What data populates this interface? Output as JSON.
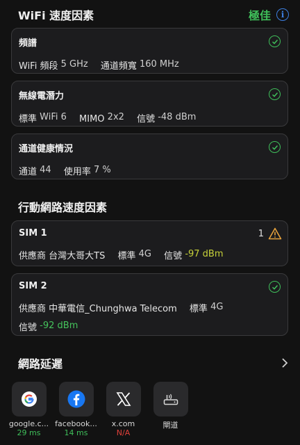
{
  "wifi_section": {
    "title": "WiFi 速度因素",
    "rating": "極佳",
    "rating_color": "#3fbf5a",
    "info_icon": "info-icon"
  },
  "cards": {
    "spectrum": {
      "title": "頻譜",
      "status": "ok",
      "band_label": "WiFi 頻段",
      "band_value": "5 GHz",
      "width_label": "通道頻寬",
      "width_value": "160 MHz"
    },
    "radio": {
      "title": "無線電潛力",
      "status": "ok",
      "std_label": "標準",
      "std_value": "WiFi 6",
      "mimo_label": "MIMO",
      "mimo_value": "2x2",
      "signal_label": "信號",
      "signal_value": "-48 dBm"
    },
    "channel": {
      "title": "通道健康情況",
      "status": "ok",
      "channel_label": "通道",
      "channel_value": "44",
      "usage_label": "使用率",
      "usage_value": "7 %"
    }
  },
  "mobile_section": {
    "title": "行動網路速度因素"
  },
  "sims": {
    "sim1": {
      "title": "SIM 1",
      "warning_count": "1",
      "carrier_label": "供應商",
      "carrier_value": "台灣大哥大TS",
      "std_label": "標準",
      "std_value": "4G",
      "signal_label": "信號",
      "signal_value": "-97 dBm",
      "signal_color": "#c7d23a"
    },
    "sim2": {
      "title": "SIM 2",
      "status": "ok",
      "carrier_label": "供應商",
      "carrier_value": "中華電信_Chunghwa Telecom",
      "std_label": "標準",
      "std_value": "4G",
      "signal_label": "信號",
      "signal_value": "-92 dBm",
      "signal_color": "#45c45c"
    }
  },
  "latency_section": {
    "title": "網路延遲",
    "targets": [
      {
        "name": "google.c...",
        "value": "29 ms",
        "icon": "google-icon",
        "state": "good"
      },
      {
        "name": "facebook...",
        "value": "14 ms",
        "icon": "facebook-icon",
        "state": "good"
      },
      {
        "name": "x.com",
        "value": "N/A",
        "icon": "x-icon",
        "state": "bad"
      },
      {
        "name": "閘道",
        "value": "",
        "icon": "router-icon",
        "state": "none"
      }
    ]
  },
  "colors": {
    "ok": "#3fbf5a",
    "bad": "#e0403a",
    "warn": "#e6a23c"
  }
}
